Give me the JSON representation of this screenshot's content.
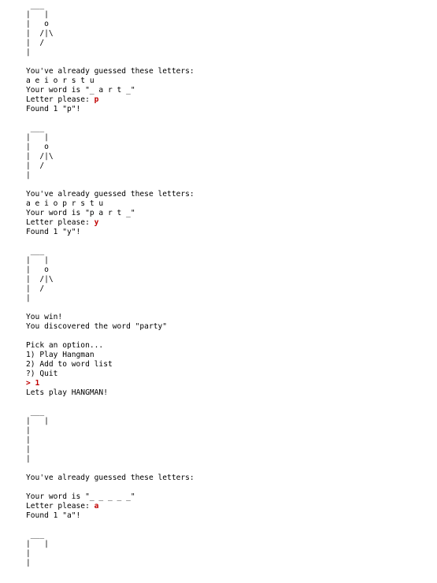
{
  "terminal": {
    "input_color": "#c00000",
    "lines": [
      {
        "text": " ___"
      },
      {
        "text": "|   |"
      },
      {
        "text": "|   o"
      },
      {
        "text": "|  /|\\"
      },
      {
        "text": "|  /"
      },
      {
        "text": "|"
      },
      {
        "text": ""
      },
      {
        "text": "You've already guessed these letters:"
      },
      {
        "text": "a e i o r s t u"
      },
      {
        "text": "Your word is \"_ a r t _\""
      },
      {
        "text": "Letter please: ",
        "input": "p"
      },
      {
        "text": "Found 1 \"p\"!"
      },
      {
        "text": ""
      },
      {
        "text": " ___"
      },
      {
        "text": "|   |"
      },
      {
        "text": "|   o"
      },
      {
        "text": "|  /|\\"
      },
      {
        "text": "|  /"
      },
      {
        "text": "|"
      },
      {
        "text": ""
      },
      {
        "text": "You've already guessed these letters:"
      },
      {
        "text": "a e i o p r s t u"
      },
      {
        "text": "Your word is \"p a r t _\""
      },
      {
        "text": "Letter please: ",
        "input": "y"
      },
      {
        "text": "Found 1 \"y\"!"
      },
      {
        "text": ""
      },
      {
        "text": " ___"
      },
      {
        "text": "|   |"
      },
      {
        "text": "|   o"
      },
      {
        "text": "|  /|\\"
      },
      {
        "text": "|  /"
      },
      {
        "text": "|"
      },
      {
        "text": ""
      },
      {
        "text": "You win!"
      },
      {
        "text": "You discovered the word \"party\""
      },
      {
        "text": ""
      },
      {
        "text": "Pick an option..."
      },
      {
        "text": "1) Play Hangman"
      },
      {
        "text": "2) Add to word list"
      },
      {
        "text": "?) Quit"
      },
      {
        "text": "",
        "input": "> 1"
      },
      {
        "text": "Lets play HANGMAN!"
      },
      {
        "text": ""
      },
      {
        "text": " ___"
      },
      {
        "text": "|   |"
      },
      {
        "text": "|"
      },
      {
        "text": "|"
      },
      {
        "text": "|"
      },
      {
        "text": "|"
      },
      {
        "text": ""
      },
      {
        "text": "You've already guessed these letters:"
      },
      {
        "text": ""
      },
      {
        "text": "Your word is \"_ _ _ _ _\""
      },
      {
        "text": "Letter please: ",
        "input": "a"
      },
      {
        "text": "Found 1 \"a\"!"
      },
      {
        "text": ""
      },
      {
        "text": " ___"
      },
      {
        "text": "|   |"
      },
      {
        "text": "|"
      },
      {
        "text": "|"
      }
    ]
  }
}
